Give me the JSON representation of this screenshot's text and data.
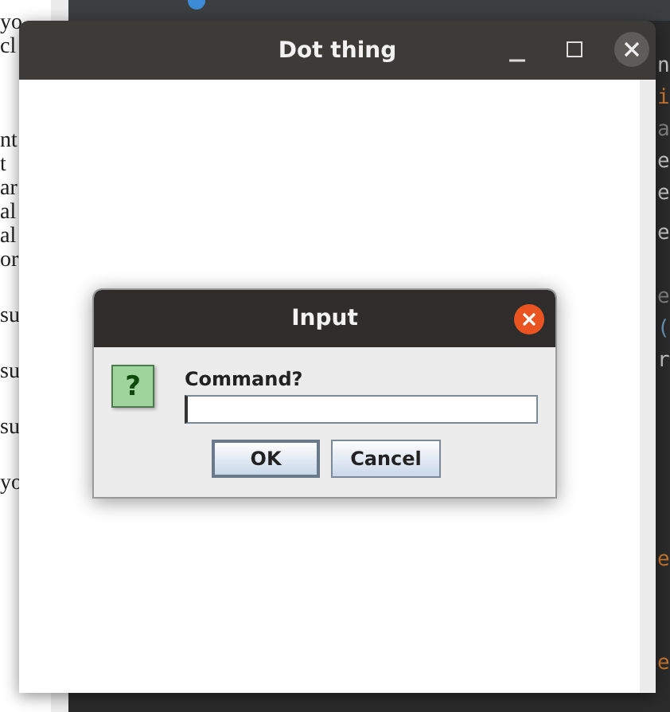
{
  "background_document": {
    "lines": [
      "yo",
      "cl",
      "nt",
      "t",
      "ar",
      "al",
      "al",
      "or",
      "su",
      "su",
      "su",
      "yo"
    ]
  },
  "editor": {
    "code_edge": [
      {
        "text": "n",
        "kind": "plain"
      },
      {
        "text": "i",
        "kind": "keyword"
      },
      {
        "text": "a",
        "kind": "comment"
      },
      {
        "text": "e",
        "kind": "plain"
      },
      {
        "text": "e",
        "kind": "plain"
      },
      {
        "text": "e",
        "kind": "plain"
      },
      {
        "text": "e",
        "kind": "comment"
      },
      {
        "text": "(",
        "kind": "call"
      },
      {
        "text": "r",
        "kind": "plain"
      },
      {
        "text": "e",
        "kind": "keyword"
      },
      {
        "text": "e",
        "kind": "keyword"
      }
    ]
  },
  "window": {
    "title": "Dot thing"
  },
  "dialog": {
    "title": "Input",
    "message": "Command?",
    "icon": "?",
    "buttons": [
      {
        "label": "OK",
        "default": true
      },
      {
        "label": "Cancel",
        "default": false
      }
    ]
  }
}
